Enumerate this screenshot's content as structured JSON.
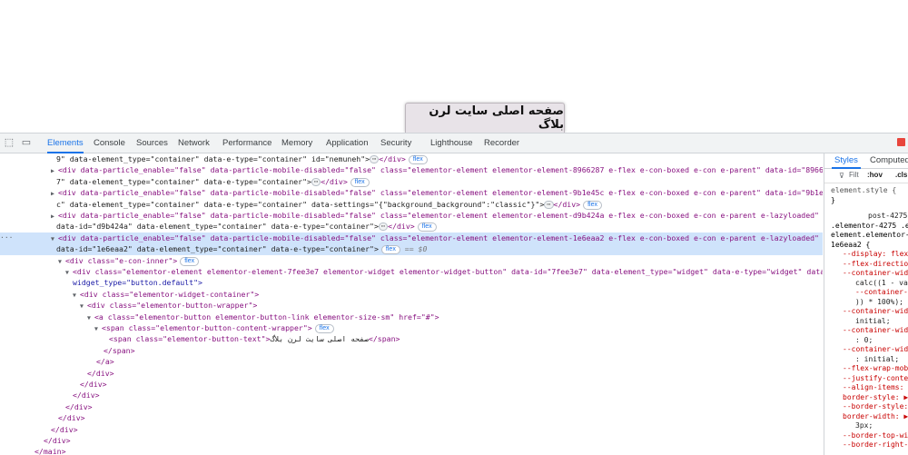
{
  "page_button_text": "صفحه اصلی سایت لرن بلاگ",
  "tabs": [
    "Elements",
    "Console",
    "Sources",
    "Network",
    "Performance",
    "Memory",
    "Application",
    "Security",
    "Lighthouse",
    "Recorder"
  ],
  "tree": {
    "l1": {
      "a": "9\" data-element_type=\"container\" data-e-type=\"container\" id=\"nemuneh\">",
      "b": "</div>",
      "pill": "flex"
    },
    "l2": {
      "a": "<div data-particle_enable=\"false\" data-particle-mobile-disabled=\"false\" class=\"elementor-element elementor-element-8966287 e-flex e-con-boxed e-con e-parent\" data-id=\"896628"
    },
    "l3": {
      "a": "7\" data-element_type=\"container\" data-e-type=\"container\">",
      "b": "</div>",
      "pill": "flex"
    },
    "l4": {
      "a": "<div data-particle_enable=\"false\" data-particle-mobile-disabled=\"false\" class=\"elementor-element elementor-element-9b1e45c e-flex e-con-boxed e-con e-parent\" data-id=\"9b1e45"
    },
    "l5": {
      "a": "c\" data-element_type=\"container\" data-e-type=\"container\" data-settings=\"{\"background_background\":\"classic\"}\">",
      "b": "</div>",
      "pill": "flex"
    },
    "l6": {
      "a": "<div data-particle_enable=\"false\" data-particle-mobile-disabled=\"false\" class=\"elementor-element elementor-element-d9b424a e-flex e-con-boxed e-con e-parent e-lazyloaded\""
    },
    "l7": {
      "a": "data-id=\"d9b424a\" data-element_type=\"container\" data-e-type=\"container\">",
      "b": "</div>",
      "pill": "flex"
    },
    "l8": {
      "a": "<div data-particle_enable=\"false\" data-particle-mobile-disabled=\"false\" class=\"elementor-element elementor-element-1e6eaa2 e-flex e-con-boxed e-con e-parent e-lazyloaded\""
    },
    "l9": {
      "a": "data-id=\"1e6eaa2\" data-element_type=\"container\" data-e-type=\"container\">",
      "pill": "flex",
      "eq": "== $0"
    },
    "l10": {
      "a": "<div class=\"e-con-inner\">",
      "pill": "flex"
    },
    "l11": {
      "a": "<div class=\"elementor-element elementor-element-7fee3e7 elementor-widget elementor-widget-button\" data-id=\"7fee3e7\" data-element_type=\"widget\" data-e-type=\"widget\" data-"
    },
    "l12": {
      "a": "widget_type=\"button.default\">"
    },
    "l13": {
      "a": "<div class=\"elementor-widget-container\">"
    },
    "l14": {
      "a": "<div class=\"elementor-button-wrapper\">"
    },
    "l15": {
      "a": "<a class=\"elementor-button elementor-button-link elementor-size-sm\" href=\"#\">"
    },
    "l16": {
      "a": "<span class=\"elementor-button-content-wrapper\">",
      "pill": "flex"
    },
    "l17": {
      "a": "<span class=\"elementor-button-text\">",
      "text": "صفحه اصلی سایت لرن بلاگ",
      "b": "</span>"
    },
    "l18": "</span>",
    "l19": "</a>",
    "l20": "</div>",
    "l21": "</div>",
    "l22": "</div>",
    "l23": "</div>",
    "l24": "</div>",
    "l25": "</div>",
    "l26": "</main>"
  },
  "sidebar": {
    "tabs": [
      "Styles",
      "Computed"
    ],
    "filter": "Filt",
    "hov": ":hov",
    "cls": ".cls",
    "lines": [
      "element.style {",
      "}",
      "post-4275",
      ".elementor-4275 .e",
      "element.elementor-",
      "1e6eaa2 {",
      "--display: flex",
      "--flex-directio",
      "--container-wid",
      "calc((1 - va",
      "--container-",
      ")) * 100%);",
      "--container-wid",
      "initial;",
      "--container-wid",
      ": 0;",
      "--container-wid",
      ": initial;",
      "--flex-wrap-mob",
      "--justify-conte",
      "--align-items:",
      "border-style: ▶",
      "--border-style:",
      "border-width: ▶",
      "3px;",
      "--border-top-wi",
      "--border-right-"
    ]
  }
}
